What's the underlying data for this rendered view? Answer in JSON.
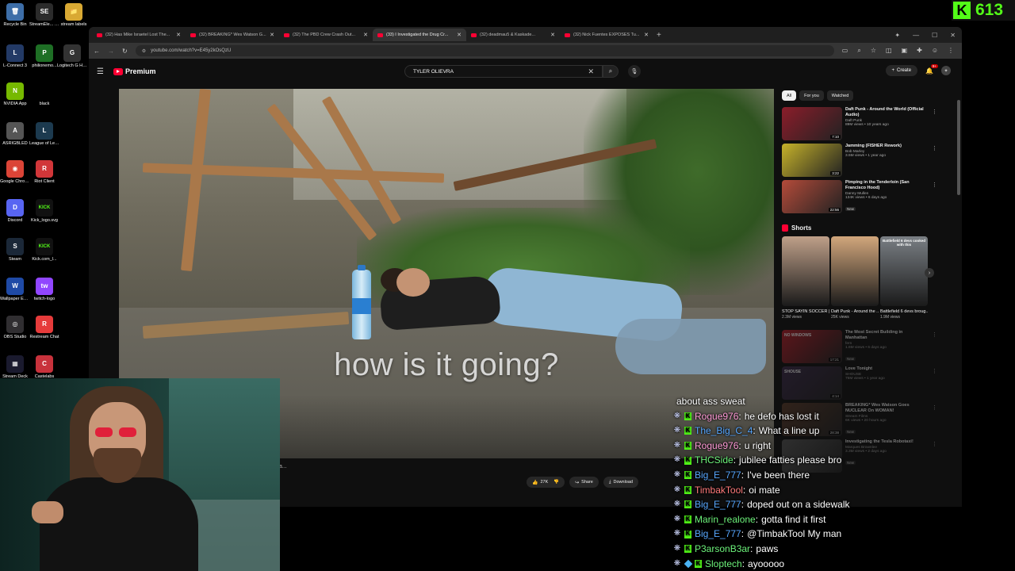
{
  "desktop": {
    "icons": [
      {
        "label": "Recycle Bin",
        "glyph": "🗑",
        "color": "#3d6ea8"
      },
      {
        "label": "StreamEle... SE.Live",
        "glyph": "SE",
        "color": "#2b2b2b"
      },
      {
        "label": "stream labels",
        "glyph": "📁",
        "color": "#d9a933"
      },
      {
        "label": "L-Connect 3",
        "glyph": "L",
        "color": "#233a66"
      },
      {
        "label": "philionemo...",
        "glyph": "P",
        "color": "#1e6f25"
      },
      {
        "label": "Logitech G HUB",
        "glyph": "G",
        "color": "#333"
      },
      {
        "label": "NVIDIA App",
        "glyph": "N",
        "color": "#76b900"
      },
      {
        "label": "black",
        "glyph": "",
        "color": "#000"
      },
      {
        "label": "ASRIGBLED",
        "glyph": "A",
        "color": "#555"
      },
      {
        "label": "League of Legends",
        "glyph": "L",
        "color": "#1c3a4f"
      },
      {
        "label": "Google Chrome",
        "glyph": "◉",
        "color": "#db4437"
      },
      {
        "label": "Riot Client",
        "glyph": "R",
        "color": "#d13639"
      },
      {
        "label": "Discord",
        "glyph": "D",
        "color": "#5865f2"
      },
      {
        "label": "Kick_logo.svg",
        "glyph": "KICK",
        "color": "#111"
      },
      {
        "label": "Steam",
        "glyph": "S",
        "color": "#1b2838"
      },
      {
        "label": "Kick.com_l...",
        "glyph": "KICK",
        "color": "#111"
      },
      {
        "label": "Wallpaper Engine",
        "glyph": "W",
        "color": "#1f4aa6"
      },
      {
        "label": "twitch-logo",
        "glyph": "tw",
        "color": "#9146ff"
      },
      {
        "label": "OBS Studio",
        "glyph": "◎",
        "color": "#302e31"
      },
      {
        "label": "Restream Chat",
        "glyph": "R",
        "color": "#e63b3b"
      },
      {
        "label": "Stream Deck",
        "glyph": "▦",
        "color": "#1a1a2e"
      },
      {
        "label": "Castelabs",
        "glyph": "C",
        "color": "#c8323c"
      }
    ]
  },
  "kick_counter": {
    "value": "613",
    "logo": "K"
  },
  "browser": {
    "tabs": [
      {
        "label": "(32) Has Mike Israetel Lost The..."
      },
      {
        "label": "(32) BREAKING* Wes Watson G..."
      },
      {
        "label": "(32) The PBD Crew Crash Out..."
      },
      {
        "label": "(33) I Investigated the Drug Cr...",
        "active": true
      },
      {
        "label": "(32) deadmau5 & Kaskade..."
      },
      {
        "label": "(32) Nick Fuentes EXPOSES Tu..."
      }
    ],
    "new_tab": "+",
    "url": "youtube.com/watch?v=E45y2kOsQzU"
  },
  "youtube": {
    "logo_text": "Premium",
    "search": {
      "value": "TYLER OLIEVRA",
      "placeholder": "Search"
    },
    "create_label": "Create",
    "notif_count": "9+",
    "video": {
      "caption": "how is it going?",
      "title_tail": "a...",
      "likes": "27K",
      "share": "Share",
      "download": "Download"
    },
    "chips": [
      "All",
      "For you",
      "Watched"
    ],
    "recs": [
      {
        "title": "Daft Punk - Around the World (Official Audio)",
        "channel": "Daft Punk",
        "meta": "89M views • 10 years ago",
        "duration": "7:10",
        "thumb": "#8b1d2a"
      },
      {
        "title": "Jamming (FISHER Rework)",
        "channel": "Bob Marley",
        "meta": "3.5M views • 1 year ago",
        "duration": "3:22",
        "thumb": "#c6b22a"
      },
      {
        "title": "Pimping in the Tenderloin (San Francisco Hood)",
        "channel": "Danny Mullen",
        "meta": "134K views • 6 days ago",
        "duration": "22:56",
        "thumb": "#b44b3a",
        "badge": "New"
      }
    ],
    "shorts_label": "Shorts",
    "shorts": [
      {
        "title": "STOP SAYIN SOCCER | ...",
        "views": "2.3M views",
        "thumb": "#bfa089"
      },
      {
        "title": "Daft Punk - Around the ...",
        "views": "25K views",
        "thumb": "#d2a77c"
      },
      {
        "title": "Battlefield 6 devs broug...",
        "views": "1.9M views",
        "thumb": "#7a7f84",
        "overlay": "Battlefield 6 devs cooked with this"
      }
    ],
    "more_recs": [
      {
        "title": "The Most Secret Building in Manhattan",
        "channel": "fern",
        "meta": "1.6M views • 6 days ago",
        "duration": "17:21",
        "thumb": "#b81e2a",
        "badge": "New",
        "overlay": "NO WINDOWS"
      },
      {
        "title": "Love Tonight",
        "channel": "SHOUSE",
        "meta": "75M views • 1 year ago",
        "duration": "4:14",
        "thumb": "#3b2a4a",
        "overlay": "SHOUSE"
      },
      {
        "title": "BREAKING* Wes Watson Goes NUCLEAR On WOMAN!",
        "channel": "Stream Films",
        "meta": "6K views • 20 hours ago",
        "duration": "28:38",
        "thumb": "#5a3a2a",
        "badge": "New"
      },
      {
        "title": "Investigating the Tesla Robotaxi!",
        "channel": "Marques Brownlee",
        "meta": "3.3M views • 2 days ago",
        "duration": "",
        "thumb": "#555",
        "badge": "New"
      }
    ]
  },
  "chat": {
    "messages": [
      {
        "user": "",
        "color": "#ffffff",
        "text": "about ass sweat",
        "badges": []
      },
      {
        "user": "Rogue976",
        "color": "#ff9bd7",
        "text": "he defo has lost it",
        "badges": [
          "wreath",
          "kick"
        ]
      },
      {
        "user": "The_Big_C_4",
        "color": "#57a7ff",
        "text": "What a line up",
        "badges": [
          "wreath",
          "kick"
        ]
      },
      {
        "user": "Rogue976",
        "color": "#ff9bd7",
        "text": "u right",
        "badges": [
          "wreath",
          "kick"
        ]
      },
      {
        "user": "THCSide",
        "color": "#6cf27a",
        "text": "jubilee fatties please bro",
        "badges": [
          "wreath",
          "kick"
        ]
      },
      {
        "user": "Big_E_777",
        "color": "#57a7ff",
        "text": "I've been there",
        "badges": [
          "wreath",
          "kick"
        ]
      },
      {
        "user": "TimbakTool",
        "color": "#ff7a7a",
        "text": "oi mate",
        "badges": [
          "wreath",
          "kick"
        ]
      },
      {
        "user": "Big_E_777",
        "color": "#57a7ff",
        "text": "doped out on a sidewalk",
        "badges": [
          "wreath",
          "kick"
        ]
      },
      {
        "user": "Marin_realone",
        "color": "#6cf27a",
        "text": "gotta find it first",
        "badges": [
          "wreath",
          "kick"
        ]
      },
      {
        "user": "Big_E_777",
        "color": "#57a7ff",
        "text": "@TimbakTool My man",
        "badges": [
          "wreath",
          "kick"
        ]
      },
      {
        "user": "P3arsonB3ar",
        "color": "#6cf27a",
        "text": "paws",
        "badges": [
          "wreath",
          "kick"
        ]
      },
      {
        "user": "Sloptech",
        "color": "#6cf27a",
        "text": "ayooooo",
        "badges": [
          "wreath",
          "gem",
          "kick"
        ]
      }
    ]
  }
}
